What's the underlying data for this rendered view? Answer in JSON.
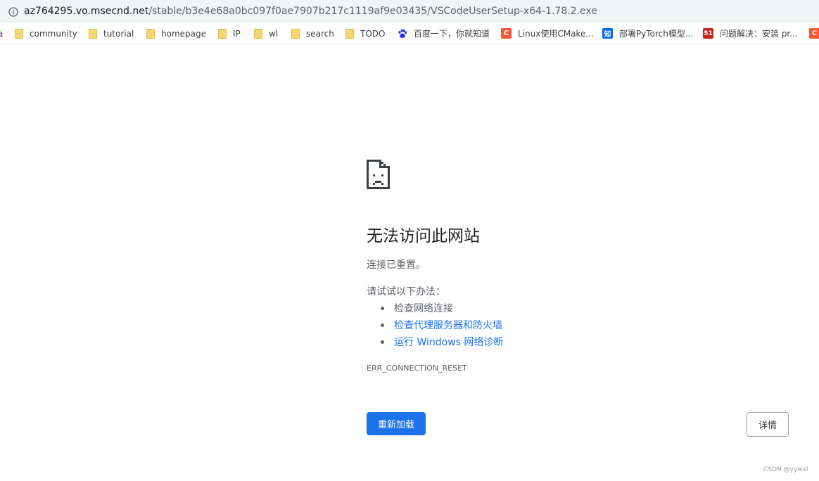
{
  "address_bar": {
    "icon": "info-icon",
    "url_host": "az764295.vo.msecnd.net",
    "url_path": "/stable/b3e4e68a0bc097f0ae7907b217c1119af9e03435/VSCodeUserSetup-x64-1.78.2.exe"
  },
  "bookmarks": [
    {
      "label": "a",
      "icon": "folder-icon"
    },
    {
      "label": "community",
      "icon": "folder-icon"
    },
    {
      "label": "tutorial",
      "icon": "folder-icon"
    },
    {
      "label": "homepage",
      "icon": "folder-icon"
    },
    {
      "label": "IP",
      "icon": "folder-icon"
    },
    {
      "label": "wl",
      "icon": "folder-icon"
    },
    {
      "label": "search",
      "icon": "folder-icon"
    },
    {
      "label": "TODO",
      "icon": "folder-icon"
    },
    {
      "label": "百度一下，你就知道",
      "icon": "baidu-icon",
      "color": "#2932e1"
    },
    {
      "label": "Linux使用CMake...",
      "icon": "csdn-icon",
      "color": "#fc5531",
      "glyph": "C"
    },
    {
      "label": "部署PyTorch模型...",
      "icon": "zhihu-icon",
      "color": "#0066ff",
      "glyph": "知"
    },
    {
      "label": "问题解决：安装 pr...",
      "icon": "51cto-icon",
      "color": "#c6231a",
      "glyph": "51"
    },
    {
      "label": "",
      "icon": "csdn-icon",
      "color": "#fc5531",
      "glyph": "C"
    }
  ],
  "error_page": {
    "icon": "sad-page-icon",
    "title": "无法访问此网站",
    "subtitle": "连接已重置。",
    "try_label": "请试试以下办法：",
    "suggestions": [
      {
        "text": "检查网络连接",
        "link": false
      },
      {
        "text": "检查代理服务器和防火墙",
        "link": true
      },
      {
        "text": "运行 Windows 网络诊断",
        "link": true
      }
    ],
    "error_code": "ERR_CONNECTION_RESET",
    "reload_label": "重新加载",
    "details_label": "详情"
  },
  "watermark": "CSDN @yywxl",
  "colors": {
    "accent": "#1a73e8",
    "link": "#1a73e8",
    "address_bar_bg": "#f1f3f4",
    "secondary_text": "#5f6368"
  }
}
